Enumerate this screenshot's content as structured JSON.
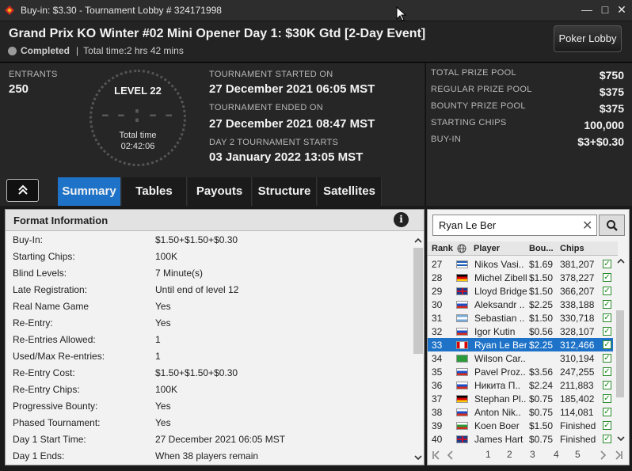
{
  "window": {
    "title": "Buy-in: $3.30 - Tournament Lobby # 324171998",
    "minimize": "—",
    "maximize": "□",
    "close": "✕"
  },
  "header": {
    "tournament_name": "Grand Prix KO Winter #02 Mini Opener Day 1: $30K Gtd [2-Day Event]",
    "status": "Completed",
    "separator": "|",
    "total_time": "Total time:2 hrs  42 mins",
    "lobby_button": "Poker Lobby"
  },
  "info": {
    "entrants_label": "ENTRANTS",
    "entrants_value": "250",
    "level": "LEVEL 22",
    "clock_digits": "--:--",
    "total_time_label": "Total time",
    "total_time_value": "02:42:06",
    "started_label": "TOURNAMENT STARTED ON",
    "started_value": "27 December 2021  06:05 MST",
    "ended_label": "TOURNAMENT ENDED ON",
    "ended_value": "27 December 2021  08:47 MST",
    "day2_label": "DAY 2 TOURNAMENT STARTS",
    "day2_value": "03 January 2022  13:05 MST"
  },
  "prizes": [
    {
      "label": "TOTAL PRIZE POOL",
      "value": "$750"
    },
    {
      "label": "REGULAR PRIZE POOL",
      "value": "$375"
    },
    {
      "label": "BOUNTY PRIZE POOL",
      "value": "$375"
    },
    {
      "label": "STARTING CHIPS",
      "value": "100,000"
    },
    {
      "label": "BUY-IN",
      "value": "$3+$0.30"
    }
  ],
  "tabs": [
    {
      "label": "Summary",
      "active": true
    },
    {
      "label": "Tables",
      "active": false
    },
    {
      "label": "Payouts",
      "active": false
    },
    {
      "label": "Structure",
      "active": false
    },
    {
      "label": "Satellites",
      "active": false
    }
  ],
  "format": {
    "title": "Format Information",
    "info_icon": "i",
    "rows": [
      {
        "k": "Buy-In:",
        "v": "$1.50+$1.50+$0.30"
      },
      {
        "k": "Starting Chips:",
        "v": "100K"
      },
      {
        "k": "Blind Levels:",
        "v": "7 Minute(s)"
      },
      {
        "k": "Late Registration:",
        "v": "Until end of level 12"
      },
      {
        "k": "Real Name Game",
        "v": "Yes"
      },
      {
        "k": "Re-Entry:",
        "v": "Yes"
      },
      {
        "k": "Re-Entries Allowed:",
        "v": "1"
      },
      {
        "k": "Used/Max Re-entries:",
        "v": "1"
      },
      {
        "k": "Re-Entry Cost:",
        "v": "$1.50+$1.50+$0.30"
      },
      {
        "k": "Re-Entry Chips:",
        "v": "100K"
      },
      {
        "k": "Progressive Bounty:",
        "v": "Yes"
      },
      {
        "k": "Phased Tournament:",
        "v": "Yes"
      },
      {
        "k": "Day 1 Start Time:",
        "v": "27 December 2021  06:05 MST"
      },
      {
        "k": "Day 1 Ends:",
        "v": "When 38 players remain"
      }
    ]
  },
  "players": {
    "search_value": "Ryan Le Ber",
    "columns": {
      "rank": "Rank",
      "player": "Player",
      "bounty": "Bou...",
      "chips": "Chips"
    },
    "rows": [
      {
        "rank": "27",
        "flag": "gr",
        "name": "Nikos Vasi..",
        "bounty": "$1.69",
        "chips": "381,207",
        "selected": false
      },
      {
        "rank": "28",
        "flag": "de",
        "name": "Michel Zibell",
        "bounty": "$1.50",
        "chips": "378,227",
        "selected": false
      },
      {
        "rank": "29",
        "flag": "gb",
        "name": "Lloyd Bridge..",
        "bounty": "$1.50",
        "chips": "366,207",
        "selected": false
      },
      {
        "rank": "30",
        "flag": "ru",
        "name": "Aleksandr ..",
        "bounty": "$2.25",
        "chips": "338,188",
        "selected": false
      },
      {
        "rank": "31",
        "flag": "ar",
        "name": "Sebastian ..",
        "bounty": "$1.50",
        "chips": "330,718",
        "selected": false
      },
      {
        "rank": "32",
        "flag": "ru",
        "name": "Igor Kutin",
        "bounty": "$0.56",
        "chips": "328,107",
        "selected": false
      },
      {
        "rank": "33",
        "flag": "ca",
        "name": "Ryan Le Ber",
        "bounty": "$2.25",
        "chips": "312,466",
        "selected": true
      },
      {
        "rank": "34",
        "flag": "br",
        "name": "Wilson Car..",
        "bounty": "",
        "chips": "310,194",
        "selected": false
      },
      {
        "rank": "35",
        "flag": "ru",
        "name": "Pavel Proz..",
        "bounty": "$3.56",
        "chips": "247,255",
        "selected": false
      },
      {
        "rank": "36",
        "flag": "ru",
        "name": "Никита П..",
        "bounty": "$2.24",
        "chips": "211,883",
        "selected": false
      },
      {
        "rank": "37",
        "flag": "de",
        "name": "Stephan Pl..",
        "bounty": "$0.75",
        "chips": "185,402",
        "selected": false
      },
      {
        "rank": "38",
        "flag": "ru",
        "name": "Anton Nik..",
        "bounty": "$0.75",
        "chips": "114,081",
        "selected": false
      },
      {
        "rank": "39",
        "flag": "bg",
        "name": "Koen Boer",
        "bounty": "$1.50",
        "chips": "Finished",
        "selected": false
      },
      {
        "rank": "40",
        "flag": "gb",
        "name": "James Hart",
        "bounty": "$0.75",
        "chips": "Finished",
        "selected": false
      }
    ],
    "pages": [
      "1",
      "2",
      "3",
      "4",
      "5"
    ]
  },
  "colors": {
    "accent": "#1e73c8",
    "window_bg": "#262626"
  }
}
